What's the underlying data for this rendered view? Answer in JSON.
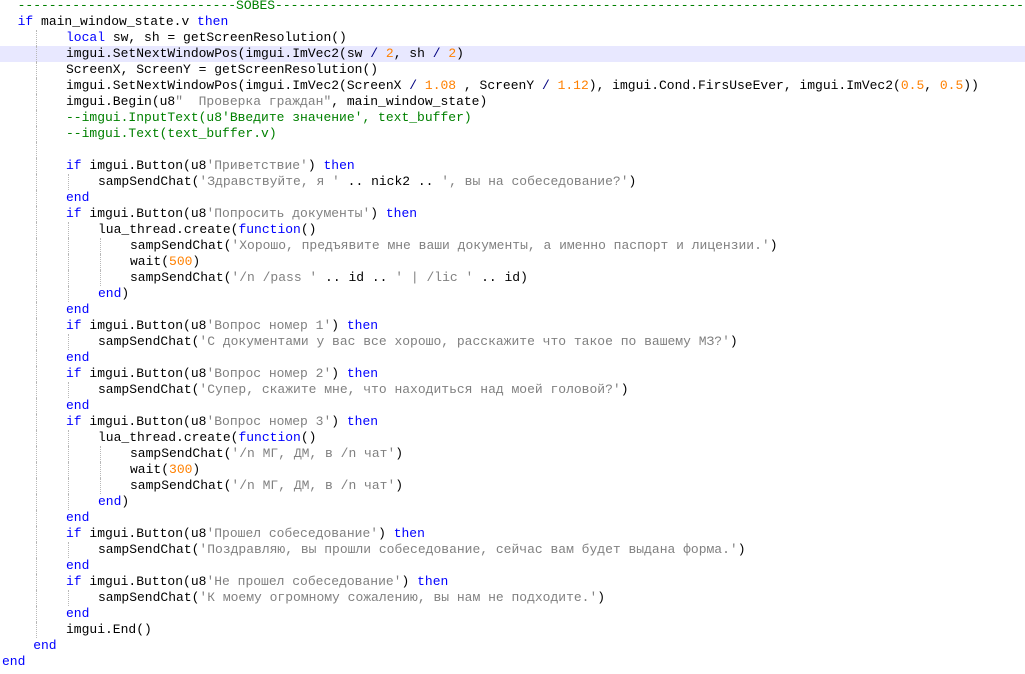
{
  "editor": {
    "current_line": 3,
    "lines": [
      {
        "indent": 0,
        "tokens": [
          [
            "cmt",
            "  ----------------------------SOBES------------------------------------------------------------------------------------------------"
          ]
        ]
      },
      {
        "indent": 0,
        "tokens": [
          [
            "kw",
            "  if"
          ],
          [
            "fn",
            " main_window_state.v "
          ],
          [
            "kw",
            "then"
          ]
        ]
      },
      {
        "indent": 1,
        "tokens": [
          [
            "kw",
            "local"
          ],
          [
            "fn",
            " sw, sh = getScreenResolution()"
          ]
        ]
      },
      {
        "indent": 1,
        "tokens": [
          [
            "fn",
            "imgui.SetNextWindowPos(imgui.ImVec2(sw "
          ],
          [
            "op",
            "/"
          ],
          [
            "fn",
            " "
          ],
          [
            "num",
            "2"
          ],
          [
            "fn",
            ", sh "
          ],
          [
            "op",
            "/"
          ],
          [
            "fn",
            " "
          ],
          [
            "num",
            "2"
          ],
          [
            "fn",
            ")"
          ]
        ]
      },
      {
        "indent": 1,
        "tokens": [
          [
            "fn",
            "ScreenX, ScreenY = getScreenResolution()"
          ]
        ]
      },
      {
        "indent": 1,
        "tokens": [
          [
            "fn",
            "imgui.SetNextWindowPos(imgui.ImVec2(ScreenX "
          ],
          [
            "op",
            "/"
          ],
          [
            "fn",
            " "
          ],
          [
            "num",
            "1.08"
          ],
          [
            "fn",
            " , ScreenY "
          ],
          [
            "op",
            "/"
          ],
          [
            "fn",
            " "
          ],
          [
            "num",
            "1.12"
          ],
          [
            "fn",
            "), imgui.Cond.FirsUseEver, imgui.ImVec2("
          ],
          [
            "num",
            "0.5"
          ],
          [
            "fn",
            ", "
          ],
          [
            "num",
            "0.5"
          ],
          [
            "fn",
            "))"
          ]
        ]
      },
      {
        "indent": 1,
        "tokens": [
          [
            "fn",
            "imgui.Begin(u8"
          ],
          [
            "str",
            "\"  Проверка граждан\""
          ],
          [
            "fn",
            ", main_window_state)"
          ]
        ]
      },
      {
        "indent": 1,
        "tokens": [
          [
            "cmt",
            "--imgui.InputText(u8'Введите значение', text_buffer)"
          ]
        ]
      },
      {
        "indent": 1,
        "tokens": [
          [
            "cmt",
            "--imgui.Text(text_buffer.v)"
          ]
        ]
      },
      {
        "indent": 1,
        "tokens": []
      },
      {
        "indent": 1,
        "tokens": [
          [
            "kw",
            "if"
          ],
          [
            "fn",
            " imgui.Button(u8"
          ],
          [
            "str",
            "'Приветствие'"
          ],
          [
            "fn",
            ") "
          ],
          [
            "kw",
            "then"
          ]
        ]
      },
      {
        "indent": 2,
        "tokens": [
          [
            "fn",
            "sampSendChat("
          ],
          [
            "str",
            "'Здравствуйте, я '"
          ],
          [
            "fn",
            " .. nick2 .. "
          ],
          [
            "str",
            "', вы на собеседование?'"
          ],
          [
            "fn",
            ")"
          ]
        ]
      },
      {
        "indent": 1,
        "tokens": [
          [
            "kw",
            "end"
          ]
        ]
      },
      {
        "indent": 1,
        "tokens": [
          [
            "kw",
            "if"
          ],
          [
            "fn",
            " imgui.Button(u8"
          ],
          [
            "str",
            "'Попросить документы'"
          ],
          [
            "fn",
            ") "
          ],
          [
            "kw",
            "then"
          ]
        ]
      },
      {
        "indent": 2,
        "tokens": [
          [
            "fn",
            "lua_thread.create("
          ],
          [
            "kw",
            "function"
          ],
          [
            "fn",
            "()"
          ]
        ]
      },
      {
        "indent": 3,
        "tokens": [
          [
            "fn",
            "sampSendChat("
          ],
          [
            "str",
            "'Хорошо, предъявите мне ваши документы, а именно паспорт и лицензии.'"
          ],
          [
            "fn",
            ")"
          ]
        ]
      },
      {
        "indent": 3,
        "tokens": [
          [
            "fn",
            "wait("
          ],
          [
            "num",
            "500"
          ],
          [
            "fn",
            ")"
          ]
        ]
      },
      {
        "indent": 3,
        "tokens": [
          [
            "fn",
            "sampSendChat("
          ],
          [
            "str",
            "'/n /pass '"
          ],
          [
            "fn",
            " .. id .. "
          ],
          [
            "str",
            "' | /lic '"
          ],
          [
            "fn",
            " .. id)"
          ]
        ]
      },
      {
        "indent": 2,
        "tokens": [
          [
            "kw",
            "end"
          ],
          [
            "fn",
            ")"
          ]
        ]
      },
      {
        "indent": 1,
        "tokens": [
          [
            "kw",
            "end"
          ]
        ]
      },
      {
        "indent": 1,
        "tokens": [
          [
            "kw",
            "if"
          ],
          [
            "fn",
            " imgui.Button(u8"
          ],
          [
            "str",
            "'Вопрос номер 1'"
          ],
          [
            "fn",
            ") "
          ],
          [
            "kw",
            "then"
          ]
        ]
      },
      {
        "indent": 2,
        "tokens": [
          [
            "fn",
            "sampSendChat("
          ],
          [
            "str",
            "'С документами у вас все хорошо, расскажите что такое по вашему МЗ?'"
          ],
          [
            "fn",
            ")"
          ]
        ]
      },
      {
        "indent": 1,
        "tokens": [
          [
            "kw",
            "end"
          ]
        ]
      },
      {
        "indent": 1,
        "tokens": [
          [
            "kw",
            "if"
          ],
          [
            "fn",
            " imgui.Button(u8"
          ],
          [
            "str",
            "'Вопрос номер 2'"
          ],
          [
            "fn",
            ") "
          ],
          [
            "kw",
            "then"
          ]
        ]
      },
      {
        "indent": 2,
        "tokens": [
          [
            "fn",
            "sampSendChat("
          ],
          [
            "str",
            "'Супер, скажите мне, что находиться над моей головой?'"
          ],
          [
            "fn",
            ")"
          ]
        ]
      },
      {
        "indent": 1,
        "tokens": [
          [
            "kw",
            "end"
          ]
        ]
      },
      {
        "indent": 1,
        "tokens": [
          [
            "kw",
            "if"
          ],
          [
            "fn",
            " imgui.Button(u8"
          ],
          [
            "str",
            "'Вопрос номер 3'"
          ],
          [
            "fn",
            ") "
          ],
          [
            "kw",
            "then"
          ]
        ]
      },
      {
        "indent": 2,
        "tokens": [
          [
            "fn",
            "lua_thread.create("
          ],
          [
            "kw",
            "function"
          ],
          [
            "fn",
            "()"
          ]
        ]
      },
      {
        "indent": 3,
        "tokens": [
          [
            "fn",
            "sampSendChat("
          ],
          [
            "str",
            "'/n МГ, ДМ, в /n чат'"
          ],
          [
            "fn",
            ")"
          ]
        ]
      },
      {
        "indent": 3,
        "tokens": [
          [
            "fn",
            "wait("
          ],
          [
            "num",
            "300"
          ],
          [
            "fn",
            ")"
          ]
        ]
      },
      {
        "indent": 3,
        "tokens": [
          [
            "fn",
            "sampSendChat("
          ],
          [
            "str",
            "'/n МГ, ДМ, в /n чат'"
          ],
          [
            "fn",
            ")"
          ]
        ]
      },
      {
        "indent": 2,
        "tokens": [
          [
            "kw",
            "end"
          ],
          [
            "fn",
            ")"
          ]
        ]
      },
      {
        "indent": 1,
        "tokens": [
          [
            "kw",
            "end"
          ]
        ]
      },
      {
        "indent": 1,
        "tokens": [
          [
            "kw",
            "if"
          ],
          [
            "fn",
            " imgui.Button(u8"
          ],
          [
            "str",
            "'Прошел собеседование'"
          ],
          [
            "fn",
            ") "
          ],
          [
            "kw",
            "then"
          ]
        ]
      },
      {
        "indent": 2,
        "tokens": [
          [
            "fn",
            "sampSendChat("
          ],
          [
            "str",
            "'Поздравляю, вы прошли собеседование, сейчас вам будет выдана форма.'"
          ],
          [
            "fn",
            ")"
          ]
        ]
      },
      {
        "indent": 1,
        "tokens": [
          [
            "kw",
            "end"
          ]
        ]
      },
      {
        "indent": 1,
        "tokens": [
          [
            "kw",
            "if"
          ],
          [
            "fn",
            " imgui.Button(u8"
          ],
          [
            "str",
            "'Не прошел собеседование'"
          ],
          [
            "fn",
            ") "
          ],
          [
            "kw",
            "then"
          ]
        ]
      },
      {
        "indent": 2,
        "tokens": [
          [
            "fn",
            "sampSendChat("
          ],
          [
            "str",
            "'К моему огромному сожалению, вы нам не подходите.'"
          ],
          [
            "fn",
            ")"
          ]
        ]
      },
      {
        "indent": 1,
        "tokens": [
          [
            "kw",
            "end"
          ]
        ]
      },
      {
        "indent": 1,
        "tokens": [
          [
            "fn",
            "imgui.End()"
          ]
        ]
      },
      {
        "indent": 0,
        "tokens": [
          [
            "kw",
            "    end"
          ]
        ]
      },
      {
        "indent": 0,
        "tokens": [
          [
            "kw",
            "end"
          ]
        ]
      }
    ]
  }
}
